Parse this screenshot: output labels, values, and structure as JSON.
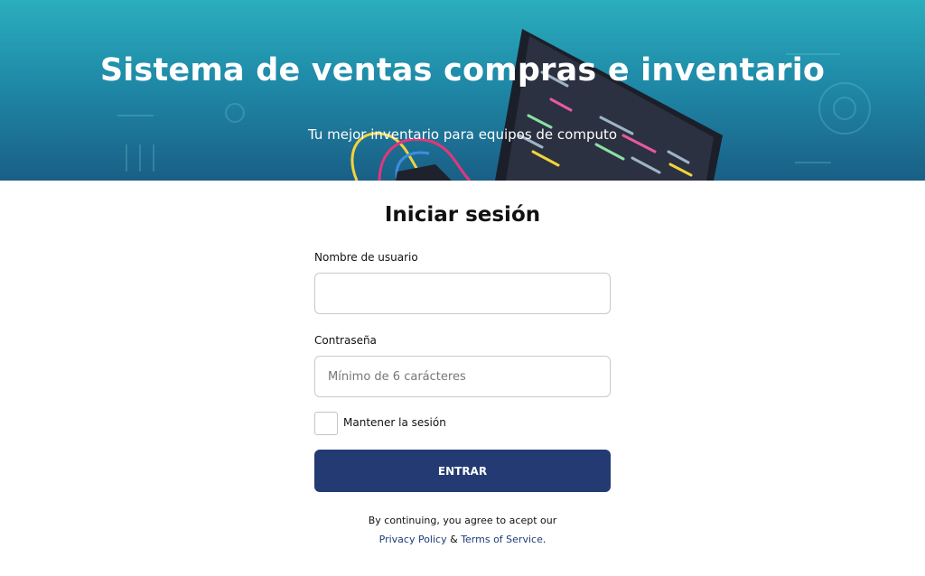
{
  "hero": {
    "title": "Sistema de ventas compras e inventario",
    "subtitle": "Tu mejor inventario para equipos de computo"
  },
  "login": {
    "heading": "Iniciar sesión",
    "username": {
      "label": "Nombre de usuario",
      "value": "",
      "placeholder": ""
    },
    "password": {
      "label": "Contraseña",
      "value": "",
      "placeholder": "Mínimo de 6 carácteres"
    },
    "remember": {
      "label": "Mantener la sesión",
      "checked": false
    },
    "submit_label": "ENTRAR"
  },
  "terms": {
    "line1": "By continuing, you agree to acept our",
    "privacy_label": "Privacy Policy",
    "ampersand": " & ",
    "terms_label": "Terms of Service",
    "end": "."
  },
  "colors": {
    "hero_top": "#2aaebd",
    "hero_bottom": "#1a5f86",
    "button": "#233a72",
    "link": "#1f3b7a"
  },
  "icons": {
    "hero_illustration": "laptop-code-illustration"
  }
}
